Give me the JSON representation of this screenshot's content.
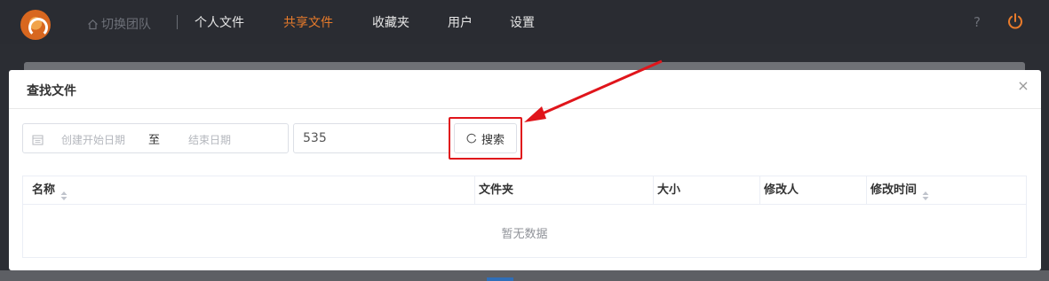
{
  "topnav": {
    "team_switch": "切换团队",
    "items": [
      "个人文件",
      "共享文件",
      "收藏夹",
      "用户",
      "设置"
    ],
    "help": "?",
    "accent": "#e87b2b"
  },
  "modal": {
    "title": "查找文件",
    "close": "×",
    "date_start_placeholder": "创建开始日期",
    "date_separator": "至",
    "date_end_placeholder": "结束日期",
    "keyword_value": "535",
    "search_label": "搜索",
    "table": {
      "columns": [
        "名称",
        "文件夹",
        "大小",
        "修改人",
        "修改时间"
      ],
      "sortable": [
        true,
        false,
        false,
        false,
        true
      ],
      "empty_text": "暂无数据"
    },
    "highlight_color": "#e0151b"
  }
}
